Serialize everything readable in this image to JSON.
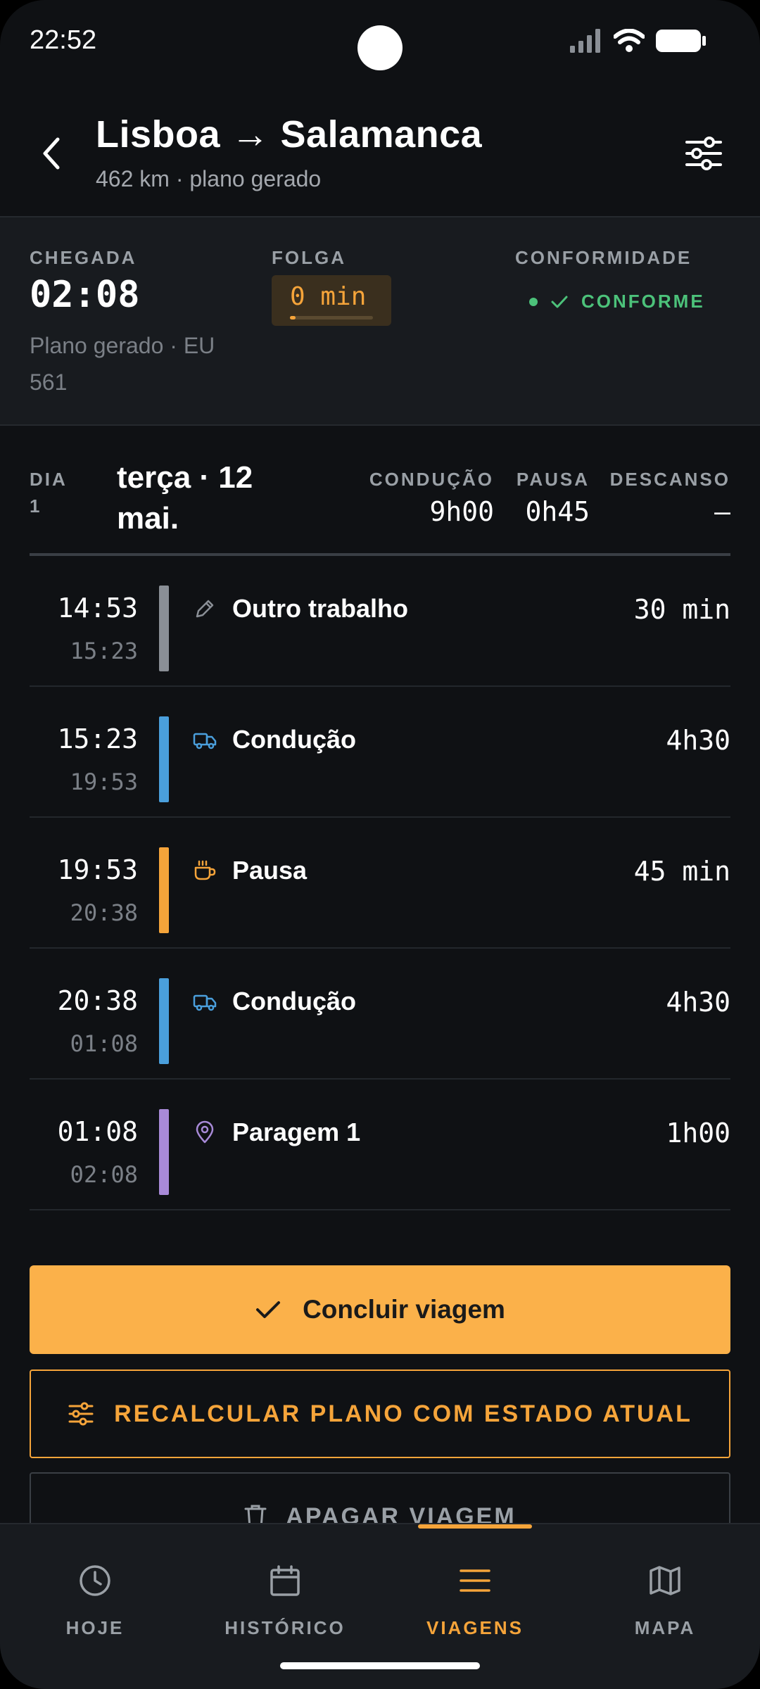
{
  "status_bar": {
    "time": "22:52"
  },
  "header": {
    "title": "Lisboa → Salamanca",
    "subtitle": "462 km · plano gerado"
  },
  "summary": {
    "arrival_label": "CHEGADA",
    "arrival_time": "02:08",
    "arrival_note": "Plano gerado · EU 561",
    "slack_label": "FOLGA",
    "slack_value": "0 min",
    "compliance_label": "CONFORMIDADE",
    "compliance_value": "CONFORME"
  },
  "day": {
    "label": "DIA",
    "number": "1",
    "date": "terça · 12 mai.",
    "stats": [
      {
        "label": "CONDUÇÃO",
        "value": "9h00"
      },
      {
        "label": "PAUSA",
        "value": "0h45"
      },
      {
        "label": "DESCANSO",
        "value": "—"
      }
    ]
  },
  "events": [
    {
      "start": "14:53",
      "end": "15:23",
      "label": "Outro trabalho",
      "duration": "30 min",
      "icon": "pencil-icon",
      "color": "#8a8f96"
    },
    {
      "start": "15:23",
      "end": "19:53",
      "label": "Condução",
      "duration": "4h30",
      "icon": "truck-icon",
      "color": "#4a9fdc"
    },
    {
      "start": "19:53",
      "end": "20:38",
      "label": "Pausa",
      "duration": "45 min",
      "icon": "coffee-icon",
      "color": "#f5a43a"
    },
    {
      "start": "20:38",
      "end": "01:08",
      "label": "Condução",
      "duration": "4h30",
      "icon": "truck-icon",
      "color": "#4a9fdc"
    },
    {
      "start": "01:08",
      "end": "02:08",
      "label": "Paragem 1",
      "duration": "1h00",
      "icon": "map-pin-icon",
      "color": "#a88ad8"
    }
  ],
  "actions": {
    "complete": "Concluir viagem",
    "recalculate": "RECALCULAR PLANO COM ESTADO ATUAL",
    "delete": "APAGAR VIAGEM"
  },
  "nav": {
    "items": [
      {
        "label": "HOJE",
        "icon": "clock-icon"
      },
      {
        "label": "HISTÓRICO",
        "icon": "calendar-icon"
      },
      {
        "label": "VIAGENS",
        "icon": "menu-icon"
      },
      {
        "label": "MAPA",
        "icon": "map-icon"
      }
    ],
    "active": "VIAGENS"
  },
  "colors": {
    "accent": "#f5a43a",
    "primary_button": "#fbb14a",
    "success": "#4cc27a",
    "background": "#0f1114"
  }
}
